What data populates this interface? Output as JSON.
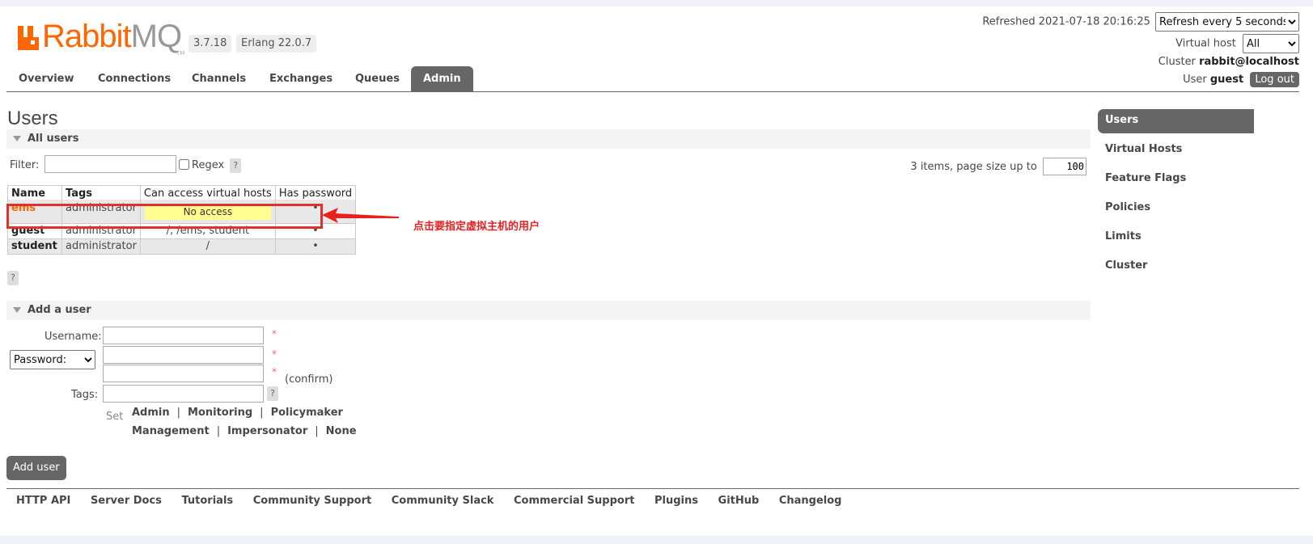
{
  "header": {
    "logo_text_main": "Rabbit",
    "logo_text_mq": "MQ",
    "logo_tm": "TM",
    "version": "3.7.18",
    "erlang": "Erlang 22.0.7",
    "refreshed": "Refreshed 2021-07-18 20:16:25",
    "refresh_option": "Refresh every 5 seconds",
    "vhost_label": "Virtual host",
    "vhost_value": "All",
    "cluster_label": "Cluster",
    "cluster_value": "rabbit@localhost",
    "user_label": "User",
    "user_value": "guest",
    "logout": "Log out"
  },
  "tabs": [
    "Overview",
    "Connections",
    "Channels",
    "Exchanges",
    "Queues",
    "Admin"
  ],
  "active_tab": "Admin",
  "page_title": "Users",
  "all_users": {
    "section": "All users",
    "filter_label": "Filter:",
    "regex_label": "Regex",
    "help": "?",
    "pagination": "3 items, page size up to",
    "page_size": "100",
    "columns": [
      "Name",
      "Tags",
      "Can access virtual hosts",
      "Has password"
    ],
    "rows": [
      {
        "name": "ems",
        "tags": "administrator",
        "vhosts": "No access",
        "has_password": "•"
      },
      {
        "name": "guest",
        "tags": "administrator",
        "vhosts": "/, /ems, student",
        "has_password": "•"
      },
      {
        "name": "student",
        "tags": "administrator",
        "vhosts": "/",
        "has_password": "•"
      }
    ]
  },
  "annotation": "点击要指定虚拟主机的用户",
  "add_user": {
    "section": "Add a user",
    "username_label": "Username:",
    "password_option": "Password:",
    "tags_label": "Tags:",
    "required": "*",
    "confirm": "(confirm)",
    "set_label": "Set",
    "tag_links_row1": [
      "Admin",
      "Monitoring",
      "Policymaker"
    ],
    "tag_links_row2": [
      "Management",
      "Impersonator",
      "None"
    ],
    "separator": "|",
    "button": "Add user"
  },
  "right_nav": [
    "Users",
    "Virtual Hosts",
    "Feature Flags",
    "Policies",
    "Limits",
    "Cluster"
  ],
  "footer": [
    "HTTP API",
    "Server Docs",
    "Tutorials",
    "Community Support",
    "Community Slack",
    "Commercial Support",
    "Plugins",
    "GitHub",
    "Changelog"
  ],
  "colors": {
    "accent": "#ff6600",
    "tab_active": "#666666",
    "annotation": "#e82020",
    "no_access_bg": "#ffff90"
  }
}
